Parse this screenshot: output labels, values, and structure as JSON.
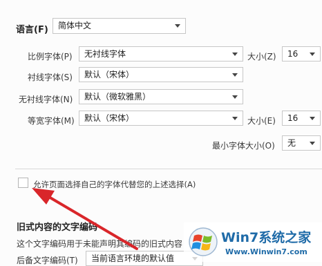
{
  "language": {
    "label": "语言(F)",
    "value": "简体中文"
  },
  "fonts": {
    "proportional": {
      "label": "比例字体(P)",
      "value": "无衬线字体",
      "size_label": "大小(Z)",
      "size_value": "16"
    },
    "serif": {
      "label": "衬线字体(S)",
      "value": "默认（宋体）"
    },
    "sans_serif": {
      "label": "无衬线字体(N)",
      "value": "默认（微软雅黑）"
    },
    "monospace": {
      "label": "等宽字体(M)",
      "value": "默认（宋体）",
      "size_label": "大小(E)",
      "size_value": "16"
    },
    "minimum_size": {
      "label": "最小字体大小(O)",
      "value": "无"
    }
  },
  "allow_page_fonts": {
    "label": "允许页面选择自己的字体代替您的上述选择(A)",
    "checked": false
  },
  "legacy_encoding": {
    "heading": "旧式内容的文字编码",
    "description": "这个文字编码用于未能声明其编码的旧式内容",
    "fallback_label": "后备文字编码(T)",
    "fallback_value": "当前语言环境的默认值"
  },
  "watermark": {
    "text": "Win7系统之家",
    "url": "Www.Winwin7.com"
  },
  "colors": {
    "annotation_arrow": "#d9262a"
  }
}
